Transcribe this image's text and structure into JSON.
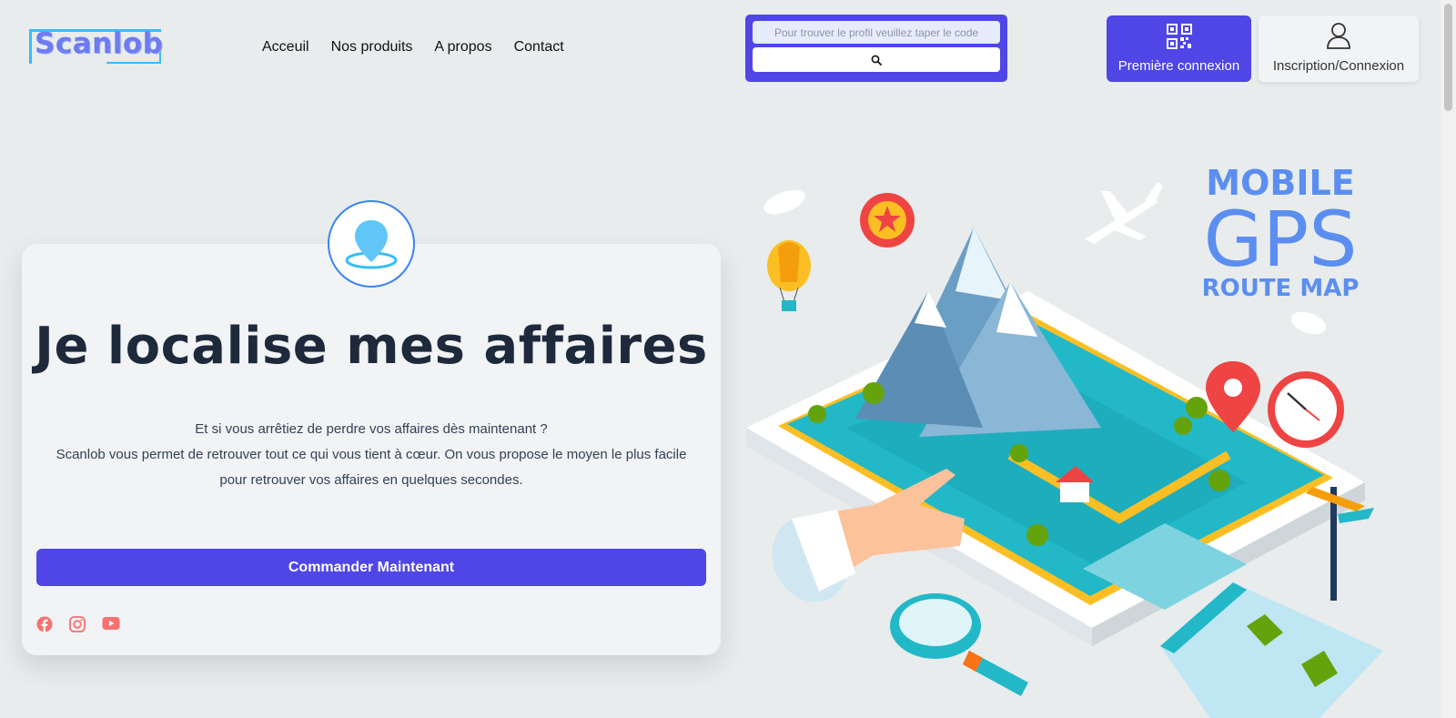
{
  "brand": {
    "name": "Scanlob"
  },
  "nav": [
    "Acceuil",
    "Nos produits",
    "A propos",
    "Contact"
  ],
  "search": {
    "placeholder": "Pour trouver le profil veuillez taper le code",
    "value": ""
  },
  "header_buttons": {
    "first_login": "Première connexion",
    "signup_login": "Inscription/Connexion"
  },
  "hero": {
    "title": "Je localise mes affaires",
    "line1": "Et si vous arrêtiez de perdre vos affaires dès maintenant ?",
    "line2": "Scanlob vous permet de retrouver tout ce qui vous tient à cœur. On vous propose le moyen le plus facile pour retrouver vos affaires en quelques secondes.",
    "cta": "Commander Maintenant"
  },
  "illustration": {
    "line1": "MOBILE",
    "line2": "GPS",
    "line3": "ROUTE MAP"
  },
  "colors": {
    "accent": "#4f46e5",
    "social": "#f87171",
    "gps_text": "#5b8ef0"
  },
  "icons": [
    "search-icon",
    "qr-code-icon",
    "user-icon",
    "map-pin-icon",
    "facebook-icon",
    "instagram-icon",
    "youtube-icon"
  ]
}
